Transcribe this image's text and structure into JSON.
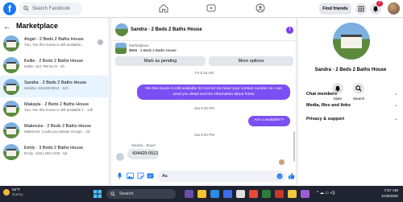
{
  "topbar": {
    "logo": "f",
    "search_placeholder": "Search Facebook",
    "find_friends": "Find friends",
    "notifications_badge": "7"
  },
  "left": {
    "title": "Marketplace",
    "conversations": [
      {
        "title": "Angel · 2 Beds 2 Baths House",
        "snippet": "You: Yes this house is still available...",
        "unread": true
      },
      {
        "title": "Kellie · 2 Beds 2 Baths House",
        "snippet": "Kellie: 434 709 5170 · 4h",
        "unread": false
      },
      {
        "title": "Sandra · 2 Beds 2 Baths House",
        "snippet": "Sandra: 434429-0512 · 11h",
        "unread": false,
        "active": true
      },
      {
        "title": "Makayla · 2 Beds 2 Baths House",
        "snippet": "You: Yes this house is still available f... 13h",
        "unread": false
      },
      {
        "title": "Makenzie · 2 Beds 2 Baths House",
        "snippet": "Makenzie: Could you please recogn... 2d",
        "unread": false
      },
      {
        "title": "Emily · 3 Beds 2 Baths House",
        "snippet": "Emily: (434) 200-1436 · 5d",
        "unread": false
      }
    ]
  },
  "chat": {
    "title": "Sandra · 2 Beds 2 Baths House",
    "listing_source": "Marketplace",
    "listing_price_title": "$869 · 2 Beds 2 Baths House",
    "mark_pending": "Mark as pending",
    "more_options": "More options",
    "timestamps": [
      "Fri 6:18 AM",
      "Sat 5:35 PM",
      "Sat 9:20 PM"
    ],
    "messages_out": [
      "Yes this house is still available for rent let me have your contact number so I can send you detail and the information about home",
      "Are u available??"
    ],
    "sender": "Sandra · Buyer",
    "message_in": "434429-0512",
    "composer_value": "Aa"
  },
  "right": {
    "name": "Sandra · 2 Beds 2 Baths House",
    "mute": "Mute",
    "search": "Search",
    "sections": [
      "Chat members",
      "Media, files and links",
      "Privacy & support"
    ]
  },
  "taskbar": {
    "temp": "52°F",
    "condition": "Sunny",
    "search": "Search",
    "time": "7:57 AM",
    "date": "11/8/2020"
  },
  "colors": {
    "brand": "#1877f2",
    "accent": "#7b4ff2",
    "active_row": "#e7f3ff"
  }
}
